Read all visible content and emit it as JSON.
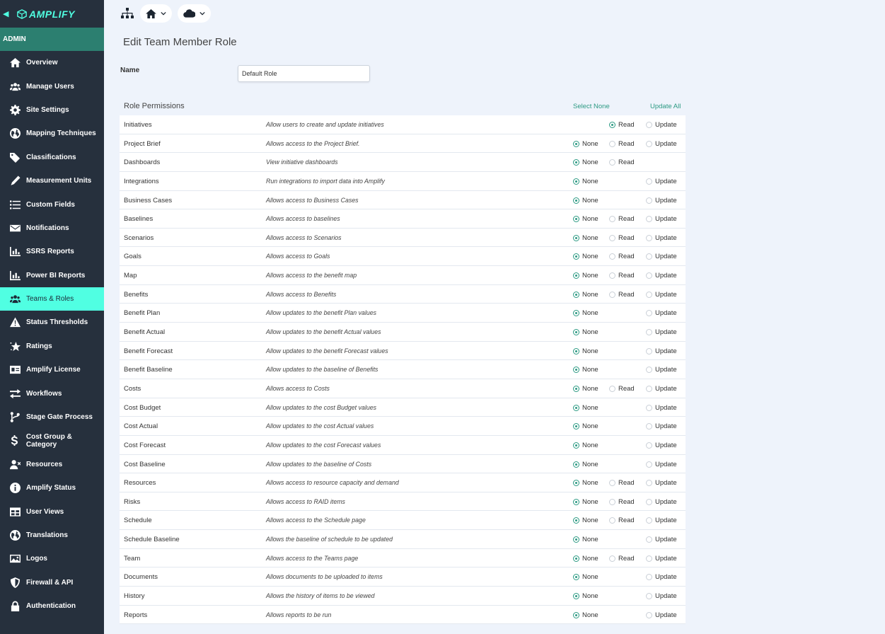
{
  "brand": {
    "name": "AMPLIFY"
  },
  "sidebar": {
    "section": "ADMIN",
    "items": [
      {
        "label": "Overview",
        "icon": "home-icon"
      },
      {
        "label": "Manage Users",
        "icon": "users-icon"
      },
      {
        "label": "Site Settings",
        "icon": "gear-icon"
      },
      {
        "label": "Mapping Techniques",
        "icon": "globe-icon"
      },
      {
        "label": "Classifications",
        "icon": "tags-icon"
      },
      {
        "label": "Measurement Units",
        "icon": "pen-icon"
      },
      {
        "label": "Custom Fields",
        "icon": "list-icon"
      },
      {
        "label": "Notifications",
        "icon": "envelope-icon"
      },
      {
        "label": "SSRS Reports",
        "icon": "chart-icon"
      },
      {
        "label": "Power BI Reports",
        "icon": "chart-icon"
      },
      {
        "label": "Teams & Roles",
        "icon": "users-icon",
        "active": true
      },
      {
        "label": "Status Thresholds",
        "icon": "warning-icon"
      },
      {
        "label": "Ratings",
        "icon": "star-icon"
      },
      {
        "label": "Amplify License",
        "icon": "id-card-icon"
      },
      {
        "label": "Workflows",
        "icon": "arrows-icon"
      },
      {
        "label": "Stage Gate Process",
        "icon": "branch-icon"
      },
      {
        "label": "Cost Group & Category",
        "icon": "dollar-icon"
      },
      {
        "label": "Resources",
        "icon": "user-x-icon"
      },
      {
        "label": "Amplify Status",
        "icon": "info-icon"
      },
      {
        "label": "User Views",
        "icon": "grid-icon"
      },
      {
        "label": "Translations",
        "icon": "globe-icon"
      },
      {
        "label": "Logos",
        "icon": "image-icon"
      },
      {
        "label": "Firewall & API",
        "icon": "shield-icon"
      },
      {
        "label": "Authentication",
        "icon": "lock-icon"
      }
    ]
  },
  "page": {
    "title": "Edit Team Member Role",
    "name_label": "Name",
    "name_value": "Default Role"
  },
  "permissions": {
    "title": "Role Permissions",
    "select_none": "Select None",
    "update_all": "Update All",
    "labels": {
      "none": "None",
      "read": "Read",
      "update": "Update"
    },
    "rows": [
      {
        "name": "Initiatives",
        "desc": "Allow users to create and update initiatives",
        "options": [
          "read",
          "update"
        ],
        "selected": "read"
      },
      {
        "name": "Project Brief",
        "desc": "Allows access to the Project Brief.",
        "options": [
          "none",
          "read",
          "update"
        ],
        "selected": "none"
      },
      {
        "name": "Dashboards",
        "desc": "View initiative dashboards",
        "options": [
          "none",
          "read"
        ],
        "selected": "none"
      },
      {
        "name": "Integrations",
        "desc": "Run integrations to import data into Amplify",
        "options": [
          "none",
          "update"
        ],
        "selected": "none"
      },
      {
        "name": "Business Cases",
        "desc": "Allows access to Business Cases",
        "options": [
          "none",
          "update"
        ],
        "selected": "none"
      },
      {
        "name": "Baselines",
        "desc": "Allows access to baselines",
        "options": [
          "none",
          "read",
          "update"
        ],
        "selected": "none"
      },
      {
        "name": "Scenarios",
        "desc": "Allows access to Scenarios",
        "options": [
          "none",
          "read",
          "update"
        ],
        "selected": "none"
      },
      {
        "name": "Goals",
        "desc": "Allows access to Goals",
        "options": [
          "none",
          "read",
          "update"
        ],
        "selected": "none"
      },
      {
        "name": "Map",
        "desc": "Allows access to the benefit map",
        "options": [
          "none",
          "read",
          "update"
        ],
        "selected": "none"
      },
      {
        "name": "Benefits",
        "desc": "Allows access to Benefits",
        "options": [
          "none",
          "read",
          "update"
        ],
        "selected": "none"
      },
      {
        "name": "Benefit Plan",
        "desc": "Allow updates to the benefit Plan values",
        "options": [
          "none",
          "update"
        ],
        "selected": "none"
      },
      {
        "name": "Benefit Actual",
        "desc": "Allow updates to the benefit Actual values",
        "options": [
          "none",
          "update"
        ],
        "selected": "none"
      },
      {
        "name": "Benefit Forecast",
        "desc": "Allow updates to the benefit Forecast values",
        "options": [
          "none",
          "update"
        ],
        "selected": "none"
      },
      {
        "name": "Benefit Baseline",
        "desc": "Allow updates to the baseline of Benefits",
        "options": [
          "none",
          "update"
        ],
        "selected": "none"
      },
      {
        "name": "Costs",
        "desc": "Allows access to Costs",
        "options": [
          "none",
          "read",
          "update"
        ],
        "selected": "none"
      },
      {
        "name": "Cost Budget",
        "desc": "Allow updates to the cost Budget values",
        "options": [
          "none",
          "update"
        ],
        "selected": "none"
      },
      {
        "name": "Cost Actual",
        "desc": "Allow updates to the cost Actual values",
        "options": [
          "none",
          "update"
        ],
        "selected": "none"
      },
      {
        "name": "Cost Forecast",
        "desc": "Allow updates to the cost Forecast values",
        "options": [
          "none",
          "update"
        ],
        "selected": "none"
      },
      {
        "name": "Cost Baseline",
        "desc": "Allow updates to the baseline of Costs",
        "options": [
          "none",
          "update"
        ],
        "selected": "none"
      },
      {
        "name": "Resources",
        "desc": "Allows access to resource capacity and demand",
        "options": [
          "none",
          "read",
          "update"
        ],
        "selected": "none"
      },
      {
        "name": "Risks",
        "desc": "Allows access to RAID items",
        "options": [
          "none",
          "read",
          "update"
        ],
        "selected": "none"
      },
      {
        "name": "Schedule",
        "desc": "Allows access to the Schedule page",
        "options": [
          "none",
          "read",
          "update"
        ],
        "selected": "none"
      },
      {
        "name": "Schedule Baseline",
        "desc": "Allows the baseline of schedule to be updated",
        "options": [
          "none",
          "update"
        ],
        "selected": "none"
      },
      {
        "name": "Team",
        "desc": "Allows access to the Teams page",
        "options": [
          "none",
          "read",
          "update"
        ],
        "selected": "none"
      },
      {
        "name": "Documents",
        "desc": "Allows documents to be uploaded to items",
        "options": [
          "none",
          "update"
        ],
        "selected": "none"
      },
      {
        "name": "History",
        "desc": "Allows the history of items to be viewed",
        "options": [
          "none",
          "update"
        ],
        "selected": "none"
      },
      {
        "name": "Reports",
        "desc": "Allows reports to be run",
        "options": [
          "none",
          "update"
        ],
        "selected": "none"
      }
    ]
  },
  "colors": {
    "sidebar_bg": "#26303d",
    "admin_bar": "#2c7f70",
    "accent": "#50ffe2",
    "radio_selected": "#2c9a83",
    "page_bg": "#eef3fb"
  }
}
